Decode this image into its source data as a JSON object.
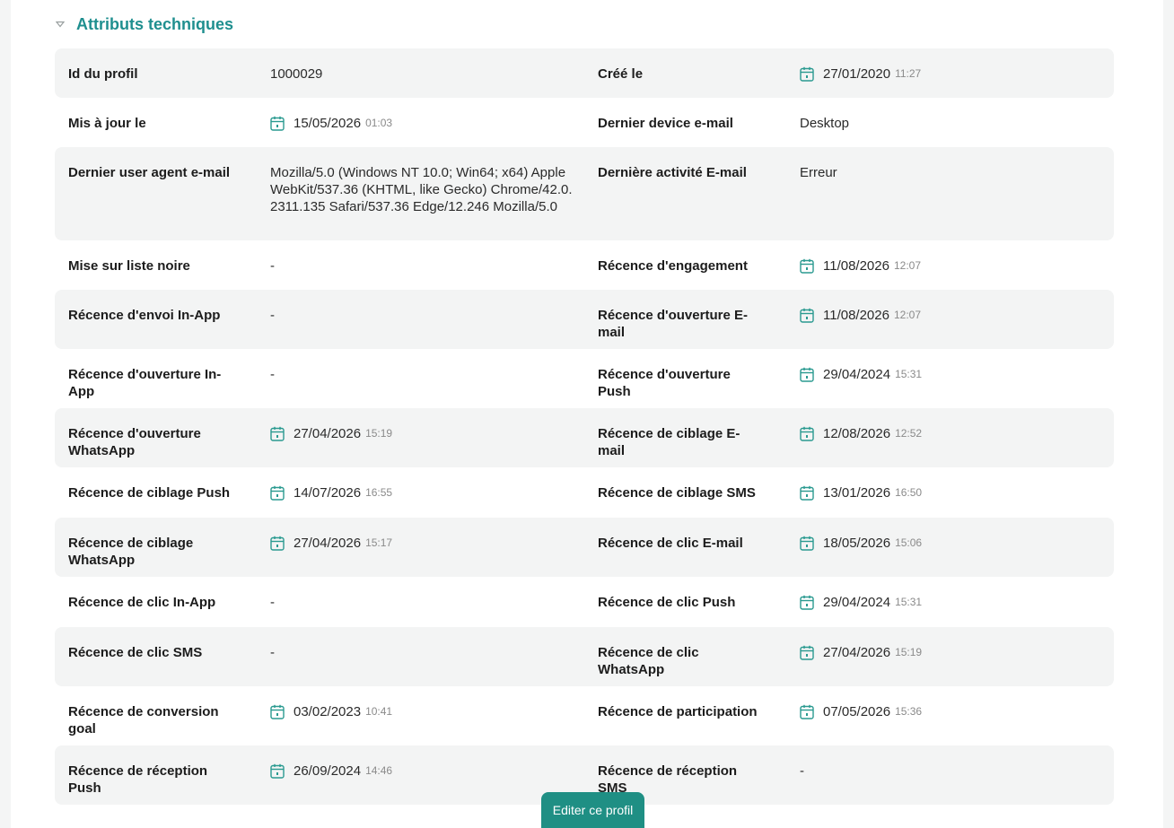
{
  "section": {
    "title": "Attributs techniques"
  },
  "rows": [
    {
      "l1": "Id du profil",
      "v1": "1000029",
      "l2": "Créé le",
      "v2d": "27/01/2020",
      "v2t": "11:27"
    },
    {
      "l1": "Mis à jour le",
      "v1d": "15/05/2026",
      "v1t": "01:03",
      "l2": "Dernier device e-mail",
      "v2": "Desktop"
    },
    {
      "l1": "Dernier user agent e-mail",
      "v1": "Mozilla/5.0 (Windows NT 10.0; Win64; x64) AppleWebKit/537.36 (KHTML, like Gecko) Chrome/42.0.2311.135 Safari/537.36 Edge/12.246 Mozilla/5.0",
      "l2": "Dernière activité E-mail",
      "v2": "Erreur"
    },
    {
      "l1": "Mise sur liste noire",
      "v1": "-",
      "l2": "Récence d'engagement",
      "v2d": "11/08/2026",
      "v2t": "12:07"
    },
    {
      "l1": "Récence d'envoi In-App",
      "v1": "-",
      "l2": "Récence d'ouverture E-mail",
      "v2d": "11/08/2026",
      "v2t": "12:07"
    },
    {
      "l1": "Récence d'ouverture In-App",
      "v1": "-",
      "l2": "Récence d'ouverture Push",
      "v2d": "29/04/2024",
      "v2t": "15:31"
    },
    {
      "l1": "Récence d'ouverture WhatsApp",
      "v1d": "27/04/2026",
      "v1t": "15:19",
      "l2": "Récence de ciblage E-mail",
      "v2d": "12/08/2026",
      "v2t": "12:52"
    },
    {
      "l1": "Récence de ciblage Push",
      "v1d": "14/07/2026",
      "v1t": "16:55",
      "l2": "Récence de ciblage SMS",
      "v2d": "13/01/2026",
      "v2t": "16:50"
    },
    {
      "l1": "Récence de ciblage WhatsApp",
      "v1d": "27/04/2026",
      "v1t": "15:17",
      "l2": "Récence de clic E-mail",
      "v2d": "18/05/2026",
      "v2t": "15:06"
    },
    {
      "l1": "Récence de clic In-App",
      "v1": "-",
      "l2": "Récence de clic Push",
      "v2d": "29/04/2024",
      "v2t": "15:31"
    },
    {
      "l1": "Récence de clic SMS",
      "v1": "-",
      "l2": "Récence de clic WhatsApp",
      "v2d": "27/04/2026",
      "v2t": "15:19"
    },
    {
      "l1": "Récence de conversion goal",
      "v1d": "03/02/2023",
      "v1t": "10:41",
      "l2": "Récence de participation",
      "v2d": "07/05/2026",
      "v2t": "15:36"
    },
    {
      "l1": "Récence de réception Push",
      "v1d": "26/09/2024",
      "v1t": "14:46",
      "l2": "Récence de réception SMS",
      "v2": "-"
    }
  ],
  "actions": {
    "edit_label": "Editer ce profil"
  },
  "colors": {
    "accent": "#1f8f8f",
    "button": "#1f8f84",
    "row_alt": "#f3f4f4"
  },
  "icons": {
    "collapse": "caret-down-icon",
    "date": "calendar-icon"
  }
}
